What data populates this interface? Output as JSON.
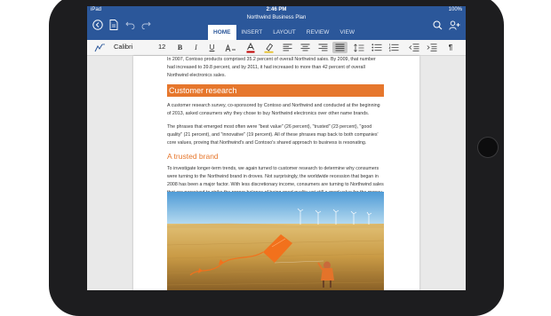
{
  "status_bar": {
    "carrier": "iPad",
    "time": "2:46 PM",
    "battery": "100%"
  },
  "titlebar": {
    "doc_title": "Northwind Business Plan"
  },
  "tabs": [
    {
      "label": "HOME",
      "active": true
    },
    {
      "label": "INSERT",
      "active": false
    },
    {
      "label": "LAYOUT",
      "active": false
    },
    {
      "label": "REVIEW",
      "active": false
    },
    {
      "label": "VIEW",
      "active": false
    }
  ],
  "ribbon": {
    "font_name": "Calibri",
    "font_size": "12"
  },
  "document": {
    "p1": "In 2007, Contoso products comprised 35.2 percent of overall Northwind sales. By 2009, that number had increased to 39.8 percent, and by 2011, it had increased to more than 42 percent of overall Northwind electronics sales.",
    "h1": "Customer research",
    "p2": "A customer research survey, co-sponsored by Contoso and Northwind and conducted at the beginning of 2013, asked consumers why they chose to buy Northwind electronics over other name brands.",
    "p3": "The phrases that emerged most often were \"best value\" (26 percent), \"trusted\" (23 percent), \"good quality\" (21 percent), and \"innovative\" (19 percent). All of these phrases map back to both companies' core values, proving that Northwind's and Contoso's shared approach to business is resonating.",
    "h2": "A trusted brand",
    "p4": "To investigate longer-term trends, we again turned to customer research to determine why consumers were turning to the Northwind brand in droves. Not surprisingly, the worldwide recession that began in 2008 has been a major factor. With less discretionary income, consumers are turning to Northwind sales that are perceived to strike the proper balance of being good quality yet still a good value for the money."
  },
  "colors": {
    "word_blue": "#2b579a",
    "accent_orange": "#e6772d"
  }
}
